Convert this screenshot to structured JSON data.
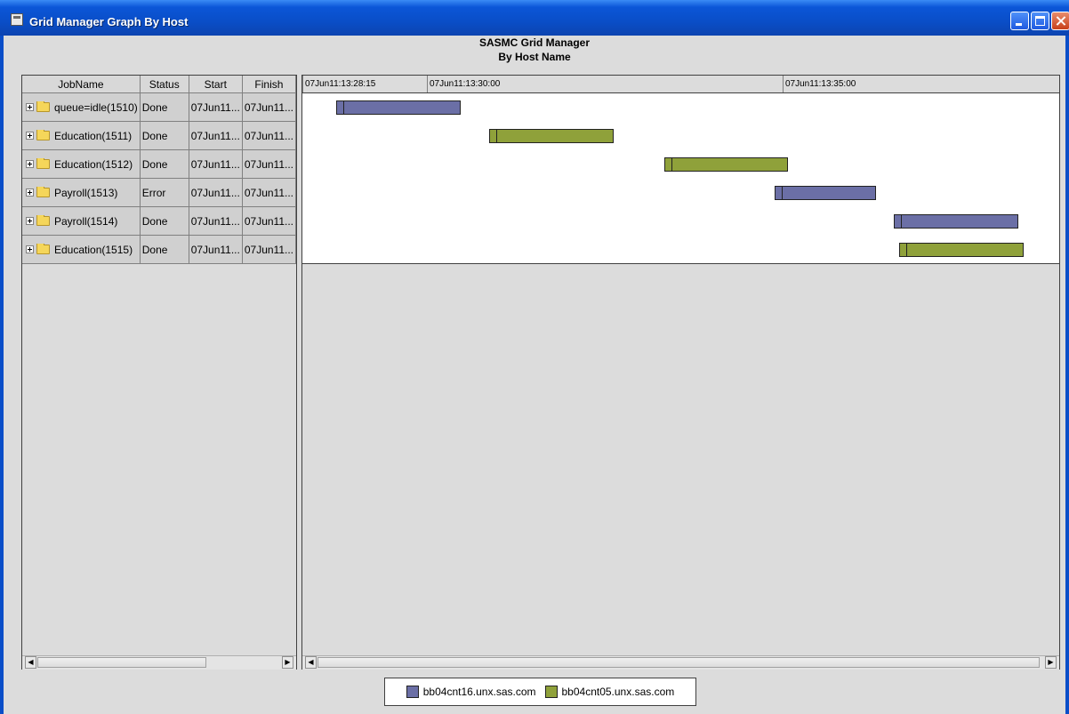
{
  "window": {
    "title": "Grid Manager Graph By Host"
  },
  "header": {
    "title": "SASMC Grid Manager",
    "subtitle": "By Host Name"
  },
  "table": {
    "columns": [
      "JobName",
      "Status",
      "Start",
      "Finish"
    ],
    "rows": [
      {
        "name": "queue=idle(1510)",
        "status": "Done",
        "start": "07Jun11...",
        "finish": "07Jun11..."
      },
      {
        "name": "Education(1511)",
        "status": "Done",
        "start": "07Jun11...",
        "finish": "07Jun11..."
      },
      {
        "name": "Education(1512)",
        "status": "Done",
        "start": "07Jun11...",
        "finish": "07Jun11..."
      },
      {
        "name": "Payroll(1513)",
        "status": "Error",
        "start": "07Jun11...",
        "finish": "07Jun11..."
      },
      {
        "name": "Payroll(1514)",
        "status": "Done",
        "start": "07Jun11...",
        "finish": "07Jun11..."
      },
      {
        "name": "Education(1515)",
        "status": "Done",
        "start": "07Jun11...",
        "finish": "07Jun11..."
      }
    ]
  },
  "chart_data": {
    "type": "gantt",
    "x_ticks": [
      "07Jun11:13:28:15",
      "07Jun11:13:30:00",
      "07Jun11:13:35:00"
    ],
    "x_tick_seconds": [
      48495,
      48600,
      48900
    ],
    "x_range_seconds": [
      48495,
      49100
    ],
    "time_unit": "seconds of day",
    "bars": [
      {
        "job": "queue=idle(1510)",
        "start": 48522,
        "end": 48627,
        "host": "bb04cnt16.unx.sas.com"
      },
      {
        "job": "Education(1511)",
        "start": 48651,
        "end": 48756,
        "host": "bb04cnt05.unx.sas.com"
      },
      {
        "job": "Education(1512)",
        "start": 48799,
        "end": 48903,
        "host": "bb04cnt05.unx.sas.com"
      },
      {
        "job": "Payroll(1513)",
        "start": 48892,
        "end": 48977,
        "host": "bb04cnt16.unx.sas.com"
      },
      {
        "job": "Payroll(1514)",
        "start": 48992,
        "end": 49097,
        "host": "bb04cnt16.unx.sas.com"
      },
      {
        "job": "Education(1515)",
        "start": 48997,
        "end": 49102,
        "host": "bb04cnt05.unx.sas.com"
      }
    ],
    "legend": [
      {
        "label": "bb04cnt16.unx.sas.com",
        "color": "#6b6fa6"
      },
      {
        "label": "bb04cnt05.unx.sas.com",
        "color": "#8fa13a"
      }
    ]
  }
}
